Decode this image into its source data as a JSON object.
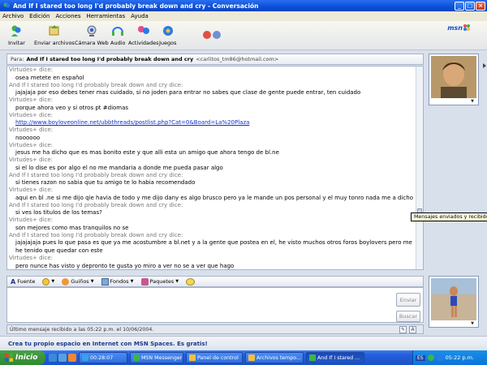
{
  "window": {
    "title": "And If I stared too long I'd probably break down and cry - Conversación",
    "controls": [
      "_",
      "□",
      "×"
    ]
  },
  "menu": [
    "Archivo",
    "Edición",
    "Acciones",
    "Herramientas",
    "Ayuda"
  ],
  "toolbar": {
    "buttons": [
      "Invitar",
      "Enviar archivos",
      "Cámara Web",
      "Audio",
      "Actividades",
      "Juegos"
    ],
    "brand": "msn"
  },
  "to_bar": {
    "label": "Para:",
    "name": "And If I stared too long I'd probably break down and cry",
    "email": "<carlitos_tm86@hotmail.com>"
  },
  "messages": [
    {
      "sender": "Virtudes+ dice:",
      "text": "osea metete en español"
    },
    {
      "sender": "And If I stared too long I'd probably break down and cry dice:",
      "text": "jajajaja por eso debes tener mas cuidado, si no joden para entrar no sabes que clase de gente puede entrar, ten cuidado"
    },
    {
      "sender": "Virtudes+ dice:",
      "text": "porque ahora veo y si otros pt #diomas"
    },
    {
      "sender": "Virtudes+ dice:",
      "text": "http://www.boyloveonline.net/ubbthreads/postlist.php?Cat=0&Board=La%20Plaza",
      "link": true
    },
    {
      "sender": "Virtudes+ dice:",
      "text": "noooooo"
    },
    {
      "sender": "Virtudes+ dice:",
      "text": "jesus me ha dicho que es mas bonito este y que alli esta un amigo que ahora tengo de bl.ne"
    },
    {
      "sender": "Virtudes+ dice:",
      "text": "si el lo dise es por algo el no me mandaria a donde me pueda pasar algo"
    },
    {
      "sender": "And If I stared too long I'd probably break down and cry dice:",
      "text": "si tienes razon no sabia que tu amigo te lo habia recomendado"
    },
    {
      "sender": "Virtudes+ dice:",
      "text": "aqui en bl .ne si me dijo qie havia de todo y me dijo dany es algo brusco pero ya le mande un pos personal y el muy tonro nada me a dicho"
    },
    {
      "sender": "And If I stared too long I'd probably break down and cry dice:",
      "text": "si ves los titulos de los temas?"
    },
    {
      "sender": "Virtudes+ dice:",
      "text": "son mejores como mas tranquilos  no se"
    },
    {
      "sender": "And If I stared too long I'd probably break down and cry dice:",
      "text": "jajajajaja pues lo que pasa es que ya me acostumbre a bl.net y a la gente que postea en el, he visto muchos otros foros boylovers pero me"
    },
    {
      "sender": "",
      "text": "he tenido que quedar con este"
    },
    {
      "sender": "Virtudes+ dice:",
      "text": "pero nunce has visto y depronto te gusta yo miro a ver no se a ver que hago"
    }
  ],
  "tooltip": "Mensajes enviados y recibidos...",
  "format_bar": [
    "Fuente",
    "",
    "Guiños",
    "Fondos",
    "Paquetes",
    ""
  ],
  "compose": {
    "send": "Enviar",
    "search": "Buscar"
  },
  "status": "Último mensaje recibido a las 05:22 p.m. el 10/06/2004.",
  "status_icon": "A",
  "spaces": "Crea tu propio espacio en Internet con MSN Spaces. Es gratis!",
  "taskbar": {
    "start": "Inicio",
    "items": [
      {
        "label": "00:28:07",
        "icon": "#3aa0e8"
      },
      {
        "label": "MSN Messenger",
        "icon": "#3cb44a"
      },
      {
        "label": "Panel de control",
        "icon": "#f0c040"
      },
      {
        "label": "Archivos tempo...",
        "icon": "#f0c040"
      },
      {
        "label": "And If I stared ...",
        "icon": "#3cb44a",
        "active": true
      }
    ],
    "lang": "ES",
    "clock": "05:22 p.m."
  }
}
